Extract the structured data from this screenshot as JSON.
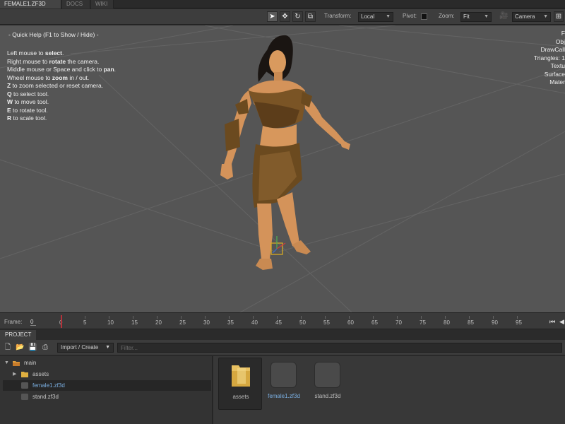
{
  "tabs": [
    {
      "label": "FEMALE1.ZF3D",
      "active": true
    },
    {
      "label": "DOCS",
      "active": false
    },
    {
      "label": "WIKI",
      "active": false
    }
  ],
  "toolbar": {
    "tools": [
      {
        "icon": "select-cursor-icon",
        "glyph": "➤",
        "active": true
      },
      {
        "icon": "move-icon",
        "glyph": "✥",
        "active": false
      },
      {
        "icon": "rotate-icon",
        "glyph": "↻",
        "active": false
      },
      {
        "icon": "scale-icon",
        "glyph": "⧉",
        "active": false
      }
    ],
    "transform_label": "Transform:",
    "transform_value": "Local",
    "pivot_label": "Pivot:",
    "zoom_label": "Zoom:",
    "zoom_value": "Fit",
    "camera_value": "Camera"
  },
  "quick_help": {
    "title": "- Quick Help (F1 to Show / Hide) -",
    "lines": [
      {
        "pre": "Left mouse to ",
        "bold": "select",
        "post": "."
      },
      {
        "pre": "Right mouse to ",
        "bold": "rotate",
        "post": " the camera."
      },
      {
        "pre": "Middle mouse or Space and click to ",
        "bold": "pan",
        "post": "."
      },
      {
        "pre": "Wheel mouse to ",
        "bold": "zoom",
        "post": " in / out."
      },
      {
        "pre": "",
        "bold": "Z",
        "post": " to zoom selected or reset camera."
      },
      {
        "pre": "",
        "bold": "Q",
        "post": " to select tool."
      },
      {
        "pre": "",
        "bold": "W",
        "post": " to move tool."
      },
      {
        "pre": "",
        "bold": "E",
        "post": " to rotate tool."
      },
      {
        "pre": "",
        "bold": "R",
        "post": " to scale tool."
      }
    ]
  },
  "stats": [
    "F",
    "Obj",
    "DrawCall",
    "Triangles: 1",
    "Textu",
    "Surface",
    "Mater"
  ],
  "timeline": {
    "frame_label": "Frame:",
    "frame_value": "0",
    "ticks": [
      "0",
      "5",
      "10",
      "15",
      "20",
      "25",
      "30",
      "35",
      "40",
      "45",
      "50",
      "55",
      "60",
      "65",
      "70",
      "75",
      "80",
      "85",
      "90",
      "95"
    ],
    "first_glyph": "⏮",
    "prev_glyph": "◀"
  },
  "project": {
    "tab_label": "PROJECT",
    "import_label": "Import / Create",
    "filter_placeholder": "Filter...",
    "tree": [
      {
        "label": "main",
        "arrow": "▼",
        "level": 0,
        "icon": "main-folder-icon",
        "selected": false
      },
      {
        "label": "assets",
        "arrow": "▶",
        "level": 1,
        "icon": "folder-icon",
        "selected": false
      },
      {
        "label": "female1.zf3d",
        "arrow": "",
        "level": 1,
        "icon": "file-icon",
        "selected": true
      },
      {
        "label": "stand.zf3d",
        "arrow": "",
        "level": 1,
        "icon": "file-icon",
        "selected": false
      }
    ],
    "assets": [
      {
        "label": "assets",
        "kind": "folder",
        "selected": true
      },
      {
        "label": "female1.zf3d",
        "kind": "file",
        "selected": false,
        "link": true
      },
      {
        "label": "stand.zf3d",
        "kind": "file",
        "selected": false
      }
    ]
  },
  "colors": {
    "accent": "#7aaee0",
    "playhead": "#b5323a",
    "viewport_bg": "#555555",
    "gizmo": "#e0b020"
  }
}
